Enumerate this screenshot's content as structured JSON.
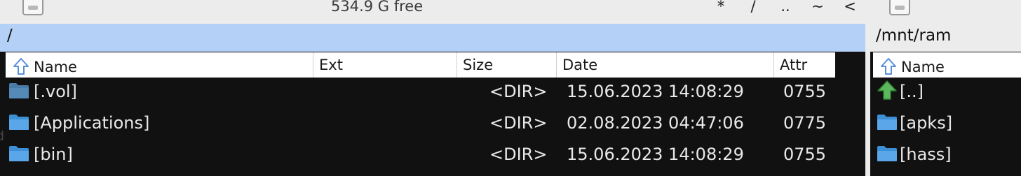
{
  "topbar": {
    "free_space": "534.9 G free",
    "quick_buttons": [
      "*",
      "/",
      "..",
      "~",
      "<"
    ]
  },
  "left_panel": {
    "path": "/",
    "columns": {
      "name": "Name",
      "ext": "Ext",
      "size": "Size",
      "date": "Date",
      "attr": "Attr"
    },
    "rows": [
      {
        "name": "[.vol]",
        "size": "<DIR>",
        "date": "15.06.2023 14:08:29",
        "attr": "0755",
        "icon": "folder-dark-icon"
      },
      {
        "name": "[Applications]",
        "size": "<DIR>",
        "date": "02.08.2023 04:47:06",
        "attr": "0775",
        "icon": "folder-icon"
      },
      {
        "name": "[bin]",
        "size": "<DIR>",
        "date": "15.06.2023 14:08:29",
        "attr": "0755",
        "icon": "folder-icon"
      }
    ]
  },
  "right_panel": {
    "path": "/mnt/ram",
    "columns": {
      "name": "Name"
    },
    "rows": [
      {
        "name": "[..]",
        "icon": "up-arrow-green-icon"
      },
      {
        "name": "[apks]",
        "icon": "folder-icon"
      },
      {
        "name": "[hass]",
        "icon": "folder-icon"
      }
    ]
  },
  "colors": {
    "path_bar_active": "#b5d0f6",
    "list_background": "#111111",
    "folder_blue": "#5aa6e8",
    "folder_dark": "#4a7aa6",
    "up_arrow_green": "#5cb85c",
    "sort_arrow_blue": "#5a8fd8"
  },
  "left_edge_text": "d"
}
